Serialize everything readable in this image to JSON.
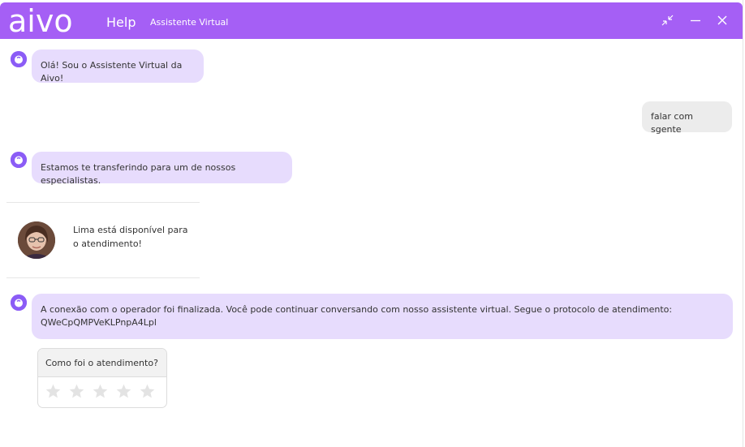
{
  "header": {
    "logo": "aivo",
    "help_label": "Help",
    "title": "Assistente Virtual",
    "controls": [
      "minimize-arrows-icon",
      "minimize-icon",
      "close-icon"
    ]
  },
  "colors": {
    "header": "#a55ff5",
    "bot_bubble": "#e7dcfd",
    "user_bubble": "#ececec",
    "bot_avatar": "#8b5cf6"
  },
  "messages": [
    {
      "from": "bot",
      "text": "Olá! Sou o Assistente Virtual da Aivo!"
    },
    {
      "from": "user",
      "text": "falar com sgente"
    },
    {
      "from": "bot",
      "text": "Estamos te transferindo para um de nossos especialistas."
    },
    {
      "from": "bot",
      "text": "A conexão com o operador foi finalizada. Você pode continuar conversando com nosso assistente virtual. Segue o protocolo de atendimento: QWeCpQMPVeKLPnpA4Lpl"
    }
  ],
  "operator": {
    "text_line1": "Lima está disponível para",
    "text_line2": "o atendimento!"
  },
  "rating": {
    "question": "Como foi o atendimento?",
    "max_stars": 5,
    "selected": 0
  }
}
